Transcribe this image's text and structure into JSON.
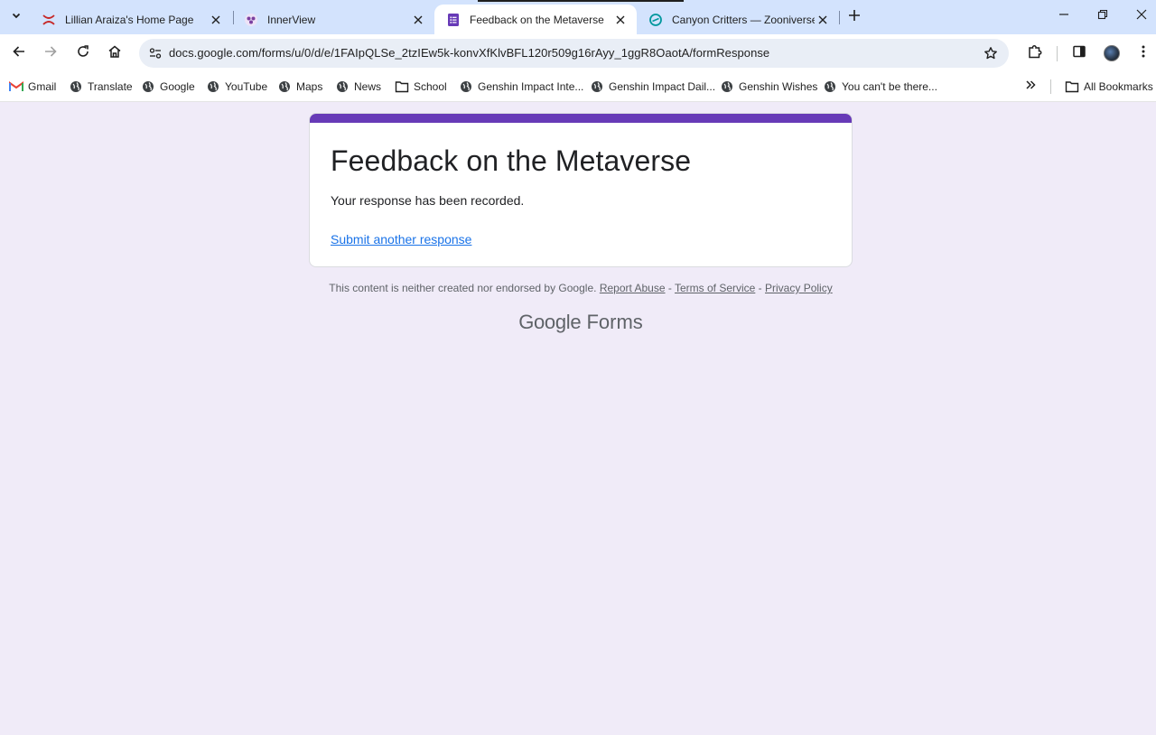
{
  "tabs": [
    {
      "title": "Lillian Araiza's Home Page",
      "favicon": "x-logo-icon"
    },
    {
      "title": "InnerView",
      "favicon": "innerview-logo-icon"
    },
    {
      "title": "Feedback on the Metaverse",
      "favicon": "google-forms-icon",
      "active": true
    },
    {
      "title": "Canyon Critters — Zooniverse",
      "favicon": "zooniverse-icon"
    }
  ],
  "toolbar": {
    "url": "docs.google.com/forms/u/0/d/e/1FAIpQLSe_2tzIEw5k-konvXfKlvBFL120r509g16rAyy_1ggR8OaotA/formResponse"
  },
  "bookmarks": [
    {
      "label": "Gmail",
      "icon": "gmail-icon"
    },
    {
      "label": "Translate",
      "icon": "globe-icon"
    },
    {
      "label": "Google",
      "icon": "globe-icon"
    },
    {
      "label": "YouTube",
      "icon": "globe-icon"
    },
    {
      "label": "Maps",
      "icon": "globe-icon"
    },
    {
      "label": "News",
      "icon": "globe-icon"
    },
    {
      "label": "School",
      "icon": "folder-icon"
    },
    {
      "label": "Genshin Impact Inte...",
      "icon": "globe-icon"
    },
    {
      "label": "Genshin Impact Dail...",
      "icon": "globe-icon"
    },
    {
      "label": "Genshin Wishes",
      "icon": "globe-icon"
    },
    {
      "label": "You can't be there...",
      "icon": "globe-icon"
    }
  ],
  "all_bookmarks_label": "All Bookmarks",
  "form": {
    "title": "Feedback on the Metaverse",
    "confirmation": "Your response has been recorded.",
    "submit_another": "Submit another response"
  },
  "footer": {
    "note": "This content is neither created nor endorsed by Google.",
    "report_abuse": "Report Abuse",
    "sep": " - ",
    "terms": "Terms of Service",
    "privacy": "Privacy Policy",
    "brand_google": "Google",
    "brand_forms": "Forms"
  },
  "colors": {
    "accent": "#673ab7",
    "link": "#1a73e8",
    "page_bg": "#f0ebf8"
  }
}
